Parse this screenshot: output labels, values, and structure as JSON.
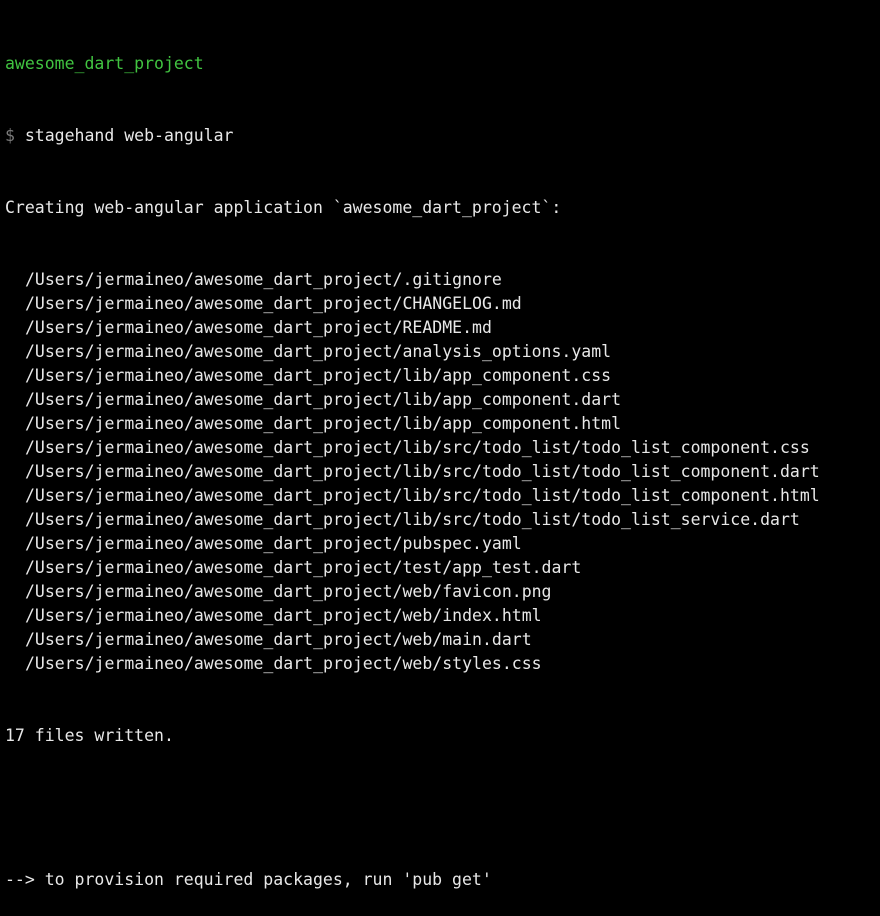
{
  "terminal": {
    "cwd": "awesome_dart_project",
    "prompt_symbol": "$",
    "command": "stagehand web-angular",
    "creating_message": "Creating web-angular application `awesome_dart_project`:",
    "files": [
      "/Users/jermaineo/awesome_dart_project/.gitignore",
      "/Users/jermaineo/awesome_dart_project/CHANGELOG.md",
      "/Users/jermaineo/awesome_dart_project/README.md",
      "/Users/jermaineo/awesome_dart_project/analysis_options.yaml",
      "/Users/jermaineo/awesome_dart_project/lib/app_component.css",
      "/Users/jermaineo/awesome_dart_project/lib/app_component.dart",
      "/Users/jermaineo/awesome_dart_project/lib/app_component.html",
      "/Users/jermaineo/awesome_dart_project/lib/src/todo_list/todo_list_component.css",
      "/Users/jermaineo/awesome_dart_project/lib/src/todo_list/todo_list_component.dart",
      "/Users/jermaineo/awesome_dart_project/lib/src/todo_list/todo_list_component.html",
      "/Users/jermaineo/awesome_dart_project/lib/src/todo_list/todo_list_service.dart",
      "/Users/jermaineo/awesome_dart_project/pubspec.yaml",
      "/Users/jermaineo/awesome_dart_project/test/app_test.dart",
      "/Users/jermaineo/awesome_dart_project/web/favicon.png",
      "/Users/jermaineo/awesome_dart_project/web/index.html",
      "/Users/jermaineo/awesome_dart_project/web/main.dart",
      "/Users/jermaineo/awesome_dart_project/web/styles.css"
    ],
    "summary": "17 files written.",
    "hint": "--> to provision required packages, run 'pub get'"
  },
  "colors": {
    "background": "#000000",
    "text": "#e8e8e8",
    "cwd": "#41c441",
    "prompt": "#7a7a7a"
  }
}
